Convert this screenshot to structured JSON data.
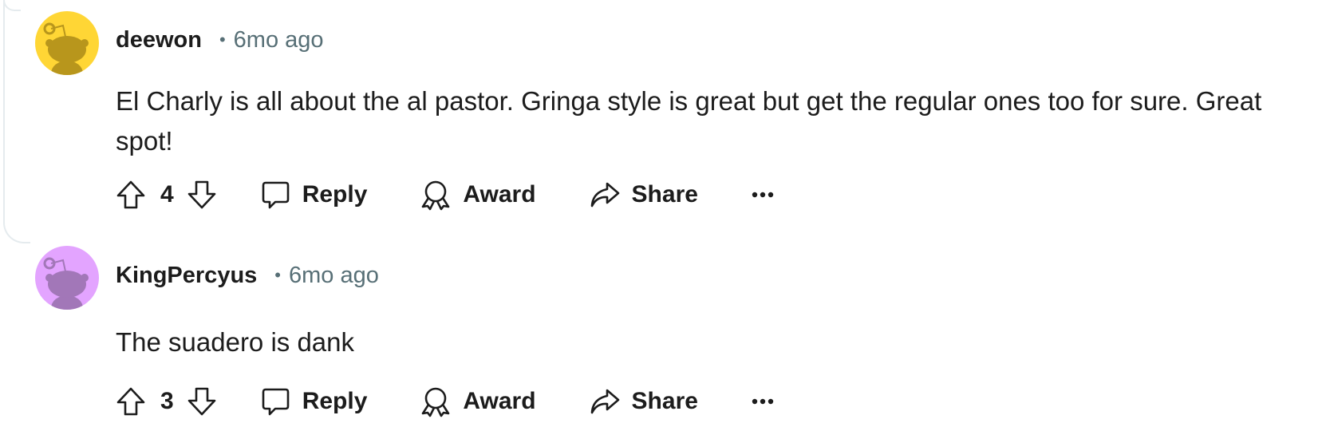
{
  "comments": [
    {
      "author": "deewon",
      "separator": "•",
      "time": "6mo ago",
      "body": "El Charly is all about the al pastor. Gringa style is great but get the regular ones too for sure. Great spot!",
      "score": "4",
      "avatar_bg": "#ffd635",
      "avatar_fg": "#b8961c",
      "actions": {
        "reply": "Reply",
        "award": "Award",
        "share": "Share",
        "more": "•••"
      }
    },
    {
      "author": "KingPercyus",
      "separator": "•",
      "time": "6mo ago",
      "body": "The suadero is dank",
      "score": "3",
      "avatar_bg": "#e3a4ff",
      "avatar_fg": "#a277b8",
      "actions": {
        "reply": "Reply",
        "award": "Award",
        "share": "Share",
        "more": "•••"
      }
    }
  ],
  "colors": {
    "text": "#1c1c1c",
    "muted": "#576f76",
    "thread_line": "#e5ebee"
  },
  "icons": [
    "reddit-snoo-avatar",
    "upvote-icon",
    "downvote-icon",
    "reply-bubble-icon",
    "award-icon",
    "share-arrow-icon",
    "more-dots-icon"
  ]
}
